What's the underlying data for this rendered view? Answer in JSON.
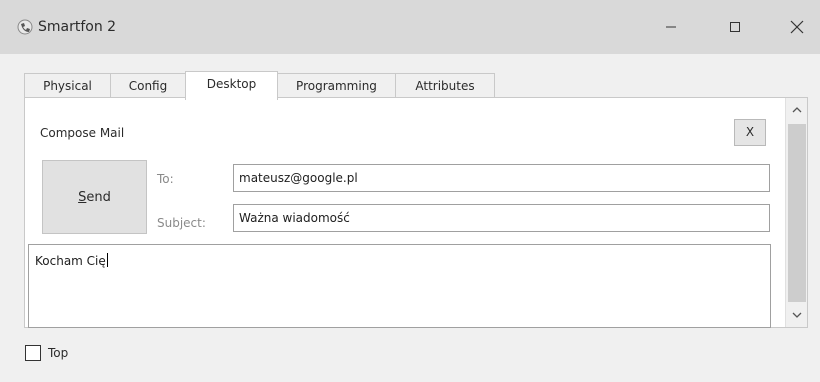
{
  "window": {
    "title": "Smartfon 2",
    "icon": "phone-app-icon",
    "minimize_glyph": "—",
    "maximize_glyph": "☐",
    "close_glyph": "✕"
  },
  "tabs": [
    {
      "label": "Physical",
      "active": false
    },
    {
      "label": "Config",
      "active": false
    },
    {
      "label": "Desktop",
      "active": true
    },
    {
      "label": "Programming",
      "active": false
    },
    {
      "label": "Attributes",
      "active": false
    }
  ],
  "compose": {
    "title": "Compose Mail",
    "close_label": "X",
    "send_label": "Send",
    "send_accel_letter": "S",
    "send_rest": "end",
    "to_label": "To:",
    "to_value": "mateusz@google.pl",
    "subject_label": "Subject:",
    "subject_value": "Ważna wiadomość",
    "body_value": "Kocham Cię"
  },
  "footer": {
    "top_label": "Top",
    "top_checked": false
  },
  "colors": {
    "titlebar": "#d9d9d9",
    "window_bg": "#f0f0f0",
    "panel_bg": "#ffffff"
  }
}
